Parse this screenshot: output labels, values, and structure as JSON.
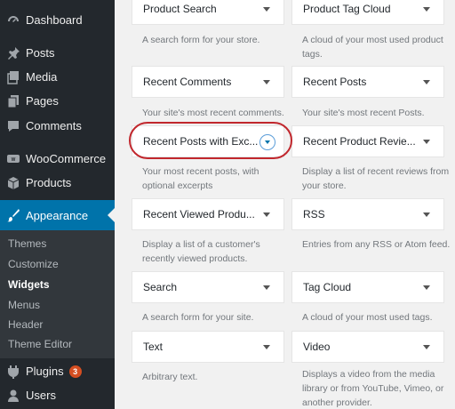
{
  "sidebar": {
    "items": [
      {
        "label": "Dashboard",
        "icon": "dashboard-icon"
      },
      {
        "label": "Posts",
        "icon": "pin-icon"
      },
      {
        "label": "Media",
        "icon": "media-icon"
      },
      {
        "label": "Pages",
        "icon": "pages-icon"
      },
      {
        "label": "Comments",
        "icon": "comment-icon"
      },
      {
        "label": "WooCommerce",
        "icon": "woocommerce-icon"
      },
      {
        "label": "Products",
        "icon": "box-icon"
      },
      {
        "label": "Appearance",
        "icon": "brush-icon"
      },
      {
        "label": "Plugins",
        "icon": "plug-icon",
        "badge": "3"
      },
      {
        "label": "Users",
        "icon": "users-icon"
      }
    ],
    "submenu": [
      "Themes",
      "Customize",
      "Widgets",
      "Menus",
      "Header",
      "Theme Editor"
    ]
  },
  "widgets": [
    {
      "title": "Product Search",
      "desc": "A search form for your store."
    },
    {
      "title": "Product Tag Cloud",
      "desc": "A cloud of your most used product tags."
    },
    {
      "title": "Recent Comments",
      "desc": "Your site's most recent comments."
    },
    {
      "title": "Recent Posts",
      "desc": "Your site's most recent Posts."
    },
    {
      "title": "Recent Posts with Exc...",
      "desc": "Your most recent posts, with optional excerpts"
    },
    {
      "title": "Recent Product Revie...",
      "desc": "Display a list of recent reviews from your store."
    },
    {
      "title": "Recent Viewed Produ...",
      "desc": "Display a list of a customer's recently viewed products."
    },
    {
      "title": "RSS",
      "desc": "Entries from any RSS or Atom feed."
    },
    {
      "title": "Search",
      "desc": "A search form for your site."
    },
    {
      "title": "Tag Cloud",
      "desc": "A cloud of your most used tags."
    },
    {
      "title": "Text",
      "desc": "Arbitrary text."
    },
    {
      "title": "Video",
      "desc": "Displays a video from the media library or from YouTube, Vimeo, or another provider."
    }
  ]
}
